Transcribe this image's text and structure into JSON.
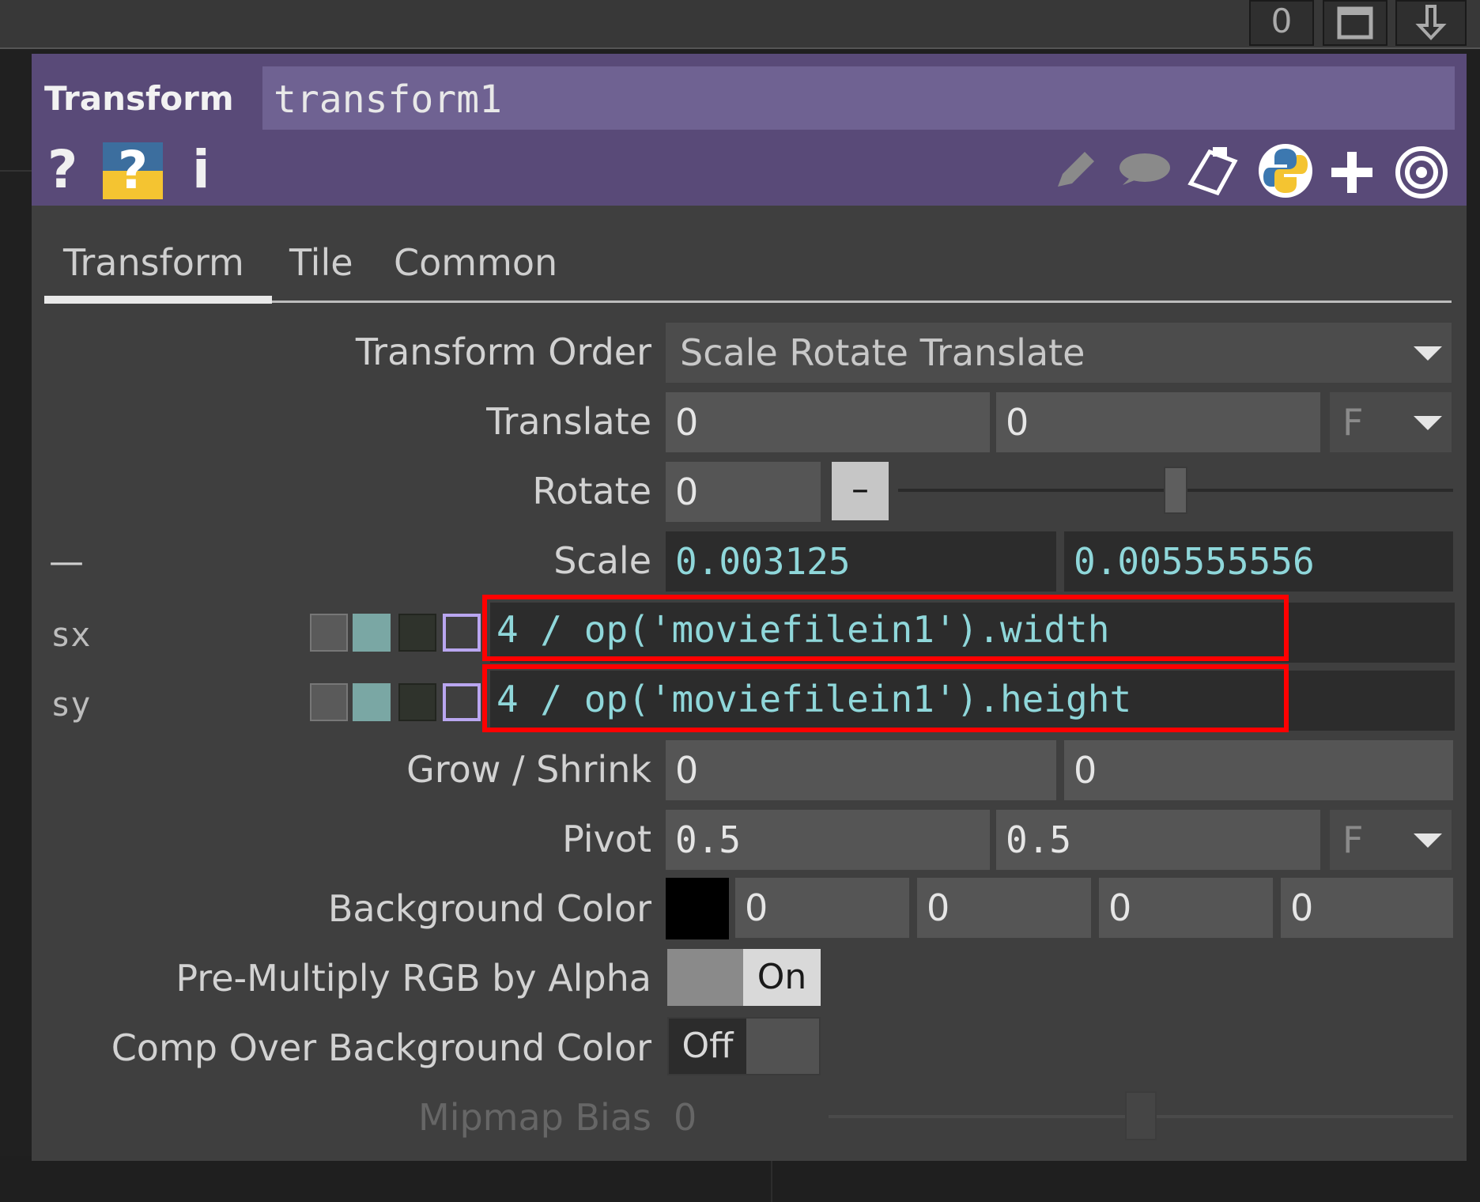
{
  "topbar": {
    "buttons": [
      "0",
      "▢",
      "⇩"
    ]
  },
  "header": {
    "op_type": "Transform",
    "op_name": "transform1"
  },
  "toolbar": {
    "help_label": "?",
    "info_label": "i"
  },
  "tabs": [
    {
      "label": "Transform",
      "active": true
    },
    {
      "label": "Tile",
      "active": false
    },
    {
      "label": "Common",
      "active": false
    }
  ],
  "params": {
    "transform_order": {
      "label": "Transform Order",
      "value": "Scale Rotate Translate"
    },
    "translate": {
      "label": "Translate",
      "x": "0",
      "y": "0",
      "unit": "F"
    },
    "rotate": {
      "label": "Rotate",
      "value": "0",
      "slider_button": "–",
      "slider_position": 0.5
    },
    "scale": {
      "label": "Scale",
      "collapse": "—",
      "x": "0.003125",
      "y": "0.005555556"
    },
    "sx": {
      "label": "sx",
      "expr": "4 / op('moviefilein1').width"
    },
    "sy": {
      "label": "sy",
      "expr": "4 / op('moviefilein1').height"
    },
    "grow_shrink": {
      "label": "Grow / Shrink",
      "x": "0",
      "y": "0"
    },
    "pivot": {
      "label": "Pivot",
      "x": "0.5",
      "y": "0.5",
      "unit": "F"
    },
    "background_color": {
      "label": "Background Color",
      "swatch": "#000000",
      "r": "0",
      "g": "0",
      "b": "0",
      "a": "0"
    },
    "premultiply": {
      "label": "Pre-Multiply RGB by Alpha",
      "value": "On"
    },
    "comp_over": {
      "label": "Comp Over Background Color",
      "value": "Off"
    },
    "mipmap_bias": {
      "label": "Mipmap Bias",
      "value": "0",
      "slider_position": 0.5
    }
  },
  "colors": {
    "header": "#594a78",
    "expr_text": "#8fd7da",
    "highlight": "#ff0000"
  }
}
